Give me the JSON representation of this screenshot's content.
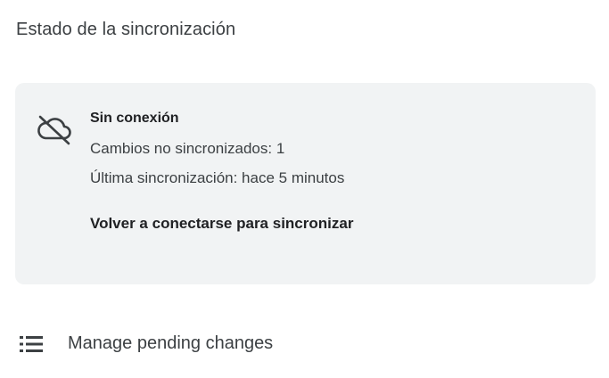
{
  "sync": {
    "section_title": "Estado de la sincronización",
    "card": {
      "icon": "cloud-off-icon",
      "status_heading": "Sin conexión",
      "unsynced_changes": "Cambios no sincronizados: 1",
      "last_sync": "Última sincronización: hace 5 minutos",
      "reconnect_label": "Volver a conectarse para sincronizar"
    }
  },
  "manage": {
    "icon": "list-icon",
    "label": "Manage pending changes"
  },
  "colors": {
    "card_background": "#f1f3f4",
    "primary_text": "#202124",
    "secondary_text": "#3c4043"
  }
}
